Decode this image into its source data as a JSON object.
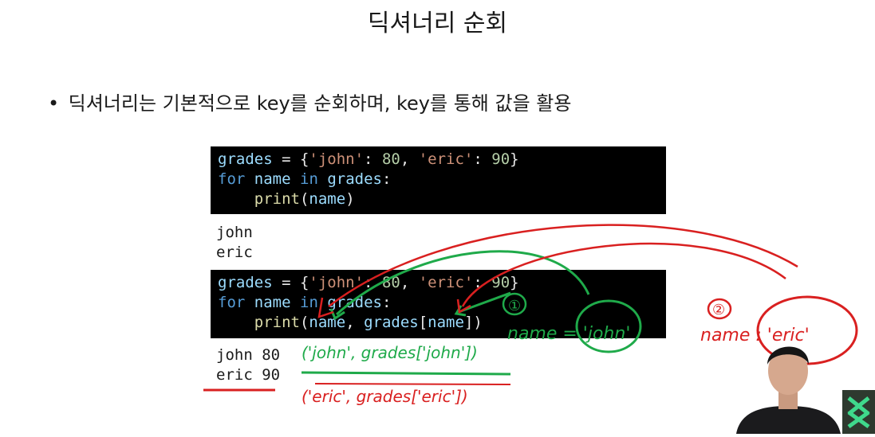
{
  "slide": {
    "title": "딕셔너리 순회",
    "bullet": "딕셔너리는 기본적으로 key를 순회하며, key를 통해 값을 활용"
  },
  "code_block_1": {
    "lines": [
      [
        "grades",
        " = {",
        "'john'",
        ": ",
        "80",
        ", ",
        "'eric'",
        ": ",
        "90",
        "}"
      ],
      [
        "for",
        " ",
        "name",
        " ",
        "in",
        " ",
        "grades",
        ":"
      ],
      [
        "    ",
        "print",
        "(",
        "name",
        ")"
      ]
    ]
  },
  "output_1": {
    "lines": [
      "john",
      "eric"
    ]
  },
  "code_block_2": {
    "lines": [
      [
        "grades",
        " = {",
        "'john'",
        ": ",
        "80",
        ", ",
        "'eric'",
        ": ",
        "90",
        "}"
      ],
      [
        "for",
        " ",
        "name",
        " ",
        "in",
        " ",
        "grades",
        ":"
      ],
      [
        "    ",
        "print",
        "(",
        "name",
        ", ",
        "grades",
        "[",
        "name",
        "])"
      ]
    ]
  },
  "output_2": {
    "lines": [
      "john 80",
      "eric 90"
    ]
  },
  "annotations": {
    "green_step": "①",
    "green_note": "name = 'john'",
    "green_expr": "('john', grades['john'])",
    "red_step": "②",
    "red_note": "name : 'eric'",
    "red_expr": "('eric', grades['eric'])"
  },
  "colors": {
    "code_bg": "#000000",
    "keyword": "#569cd6",
    "string": "#ce9178",
    "number": "#b5cea8",
    "ink_green": "#1faa4a",
    "ink_red": "#d92020",
    "logo_accent": "#3fd98c"
  }
}
